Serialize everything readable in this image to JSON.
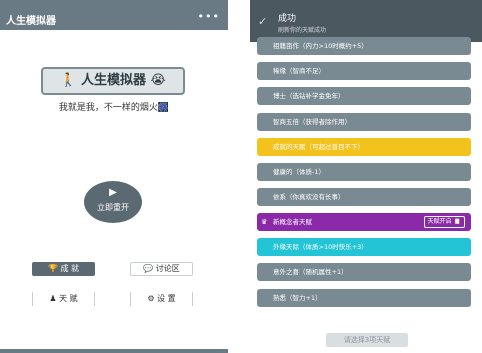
{
  "left": {
    "title": "人生模拟器",
    "more_icon": "•••",
    "logo_text": "🚶 人生模拟器 😭",
    "tagline": "我就是我，不一样的烟火🎆",
    "start_icon": "▶",
    "start_label": "立即重开",
    "achievements_label": "🏆 成 就",
    "forum_label": "💬 讨论区",
    "talents_label": "♟ 天 赋",
    "settings_label": "⚙ 设 置",
    "colors": {
      "primary": "#5b6a72",
      "logo_bg": "#dfe4e6"
    }
  },
  "right": {
    "status_text": "",
    "toast": {
      "icon": "✓",
      "title": "成功",
      "message": "刷新你的天赋成功"
    },
    "talents": [
      {
        "text": "祖籍亩作（内力>10时概约+5）",
        "color": "gray"
      },
      {
        "text": "稀缘（智商不足）",
        "color": "gray"
      },
      {
        "text": "博士（选钻补学金免年）",
        "color": "gray"
      },
      {
        "text": "智商五倍（获得者除作用）",
        "color": "gray"
      },
      {
        "text": "成就的天赋（可超过普目不下）",
        "color": "yellow"
      },
      {
        "text": "健康的（体质-1）",
        "color": "gray"
      },
      {
        "text": "依系（你真欢没有长事）",
        "color": "gray"
      },
      {
        "text": "新概念者天赋",
        "color": "purple",
        "icon": "♛",
        "tag": "天赋开启 📋"
      },
      {
        "text": "外缘天际（体质>10时快乐+3）",
        "color": "cyan"
      },
      {
        "text": "意外之喜（随机属性+1）",
        "color": "gray"
      },
      {
        "text": "熟悉（智力+1）",
        "color": "gray"
      }
    ],
    "confirm_label": "请选择3项天赋"
  }
}
